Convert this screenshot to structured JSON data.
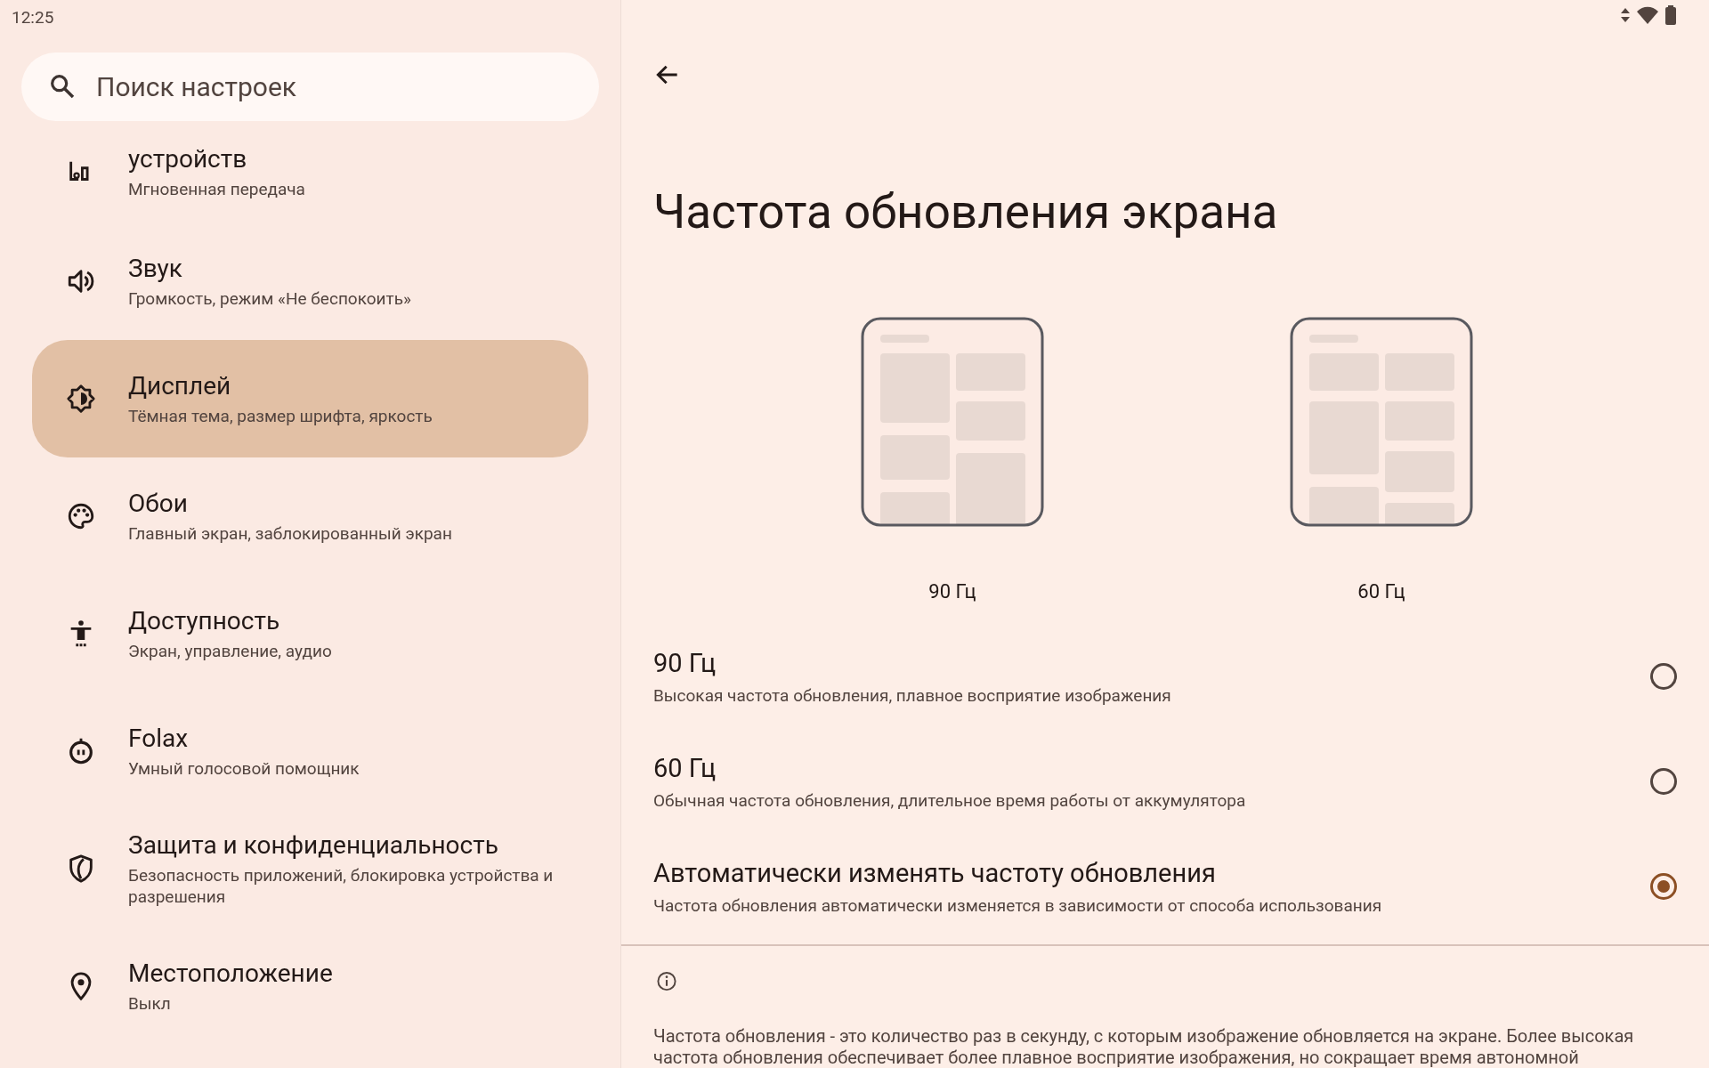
{
  "status_bar": {
    "time": "12:25"
  },
  "search": {
    "placeholder": "Поиск настроек"
  },
  "sidebar": {
    "items": [
      {
        "kind": "devices",
        "title": "устройств",
        "subtitle": "Мгновенная передача",
        "selected": false
      },
      {
        "kind": "sound",
        "title": "Звук",
        "subtitle": "Громкость, режим «Не беспокоить»",
        "selected": false
      },
      {
        "kind": "display",
        "title": "Дисплей",
        "subtitle": "Тёмная тема, размер шрифта, яркость",
        "selected": true
      },
      {
        "kind": "palette",
        "title": "Обои",
        "subtitle": "Главный экран, заблокированный экран",
        "selected": false
      },
      {
        "kind": "accessibility",
        "title": "Доступность",
        "subtitle": "Экран, управление, аудио",
        "selected": false
      },
      {
        "kind": "assistant",
        "title": "Folax",
        "subtitle": "Умный голосовой помощник",
        "selected": false
      },
      {
        "kind": "shield",
        "title": "Защита и конфиденциальность",
        "subtitle": "Безопасность приложений, блокировка устройства и разрешения",
        "selected": false
      },
      {
        "kind": "location",
        "title": "Местоположение",
        "subtitle": "Выкл",
        "selected": false
      }
    ]
  },
  "page": {
    "title": "Частота обновления экрана",
    "previews": [
      {
        "kind": "fast",
        "label": "90 Гц"
      },
      {
        "kind": "slow",
        "label": "60 Гц"
      }
    ],
    "options": [
      {
        "title": "90 Гц",
        "subtitle": "Высокая частота обновления, плавное восприятие изображения",
        "selected": false
      },
      {
        "title": "60 Гц",
        "subtitle": "Обычная частота обновления, длительное время работы от аккумулятора",
        "selected": false
      },
      {
        "title": "Автоматически изменять частоту обновления",
        "subtitle": "Частота обновления автоматически изменяется в зависимости от способа использования",
        "selected": true
      }
    ],
    "info": "Частота обновления - это количество раз в секунду, с которым изображение обновляется на экране. Более высокая частота обновления обеспечивает более плавное восприятие изображения, но сокращает время автономной"
  }
}
